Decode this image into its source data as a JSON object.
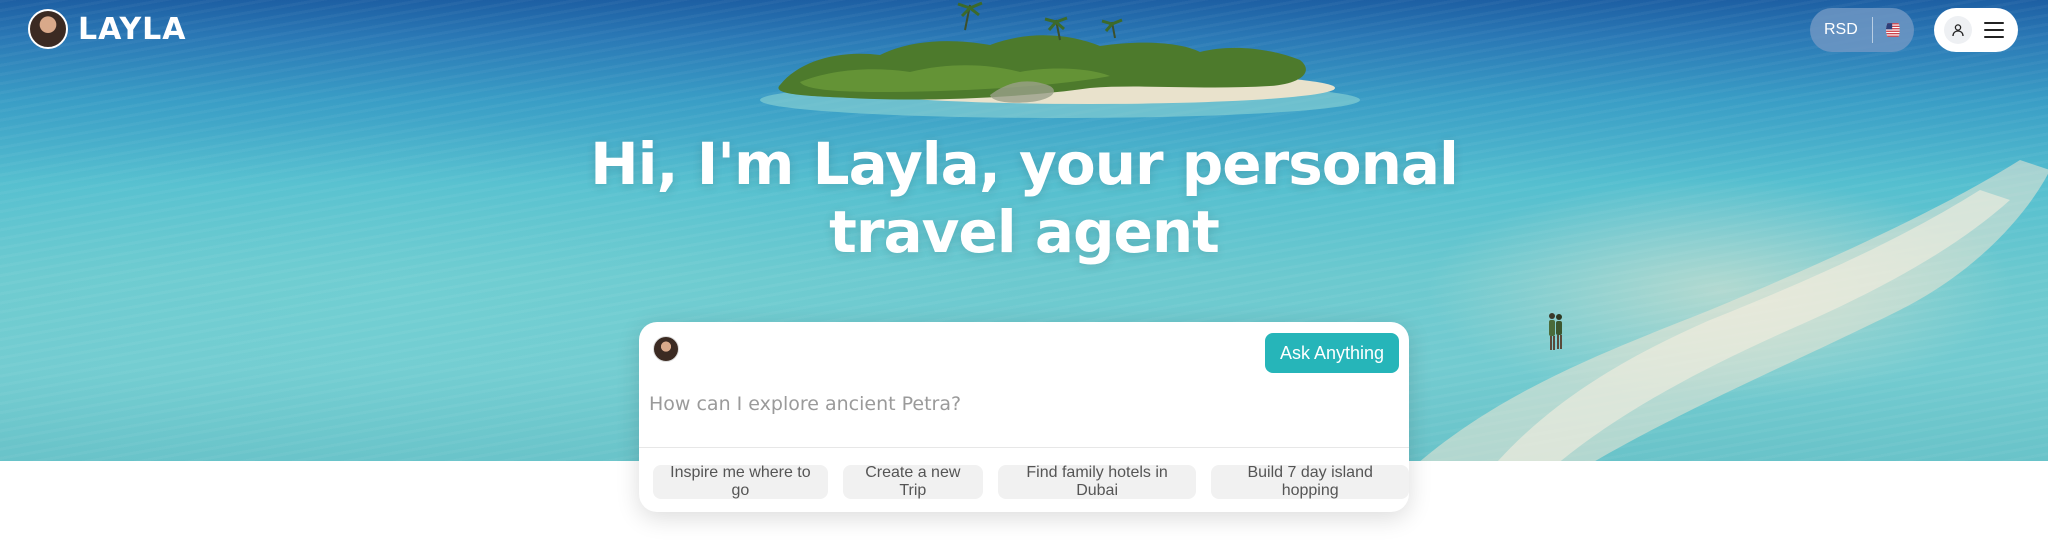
{
  "header": {
    "brand": "LAYLA",
    "currency": "RSD",
    "flag_icon": "us-flag-icon",
    "user_icon": "user-icon",
    "menu_icon": "hamburger-menu-icon"
  },
  "hero": {
    "headline_line1": "Hi, I'm Layla, your personal",
    "headline_line2": "travel agent"
  },
  "chat": {
    "ask_button": "Ask Anything",
    "placeholder": "How can I explore ancient Petra?",
    "suggestions": [
      "Inspire me where to go",
      "Create a new Trip",
      "Find family hotels in Dubai",
      "Build 7 day island hopping"
    ]
  },
  "colors": {
    "accent": "#26b5b9",
    "headline": "#ffffff",
    "chip_bg": "#f1f1f1"
  }
}
